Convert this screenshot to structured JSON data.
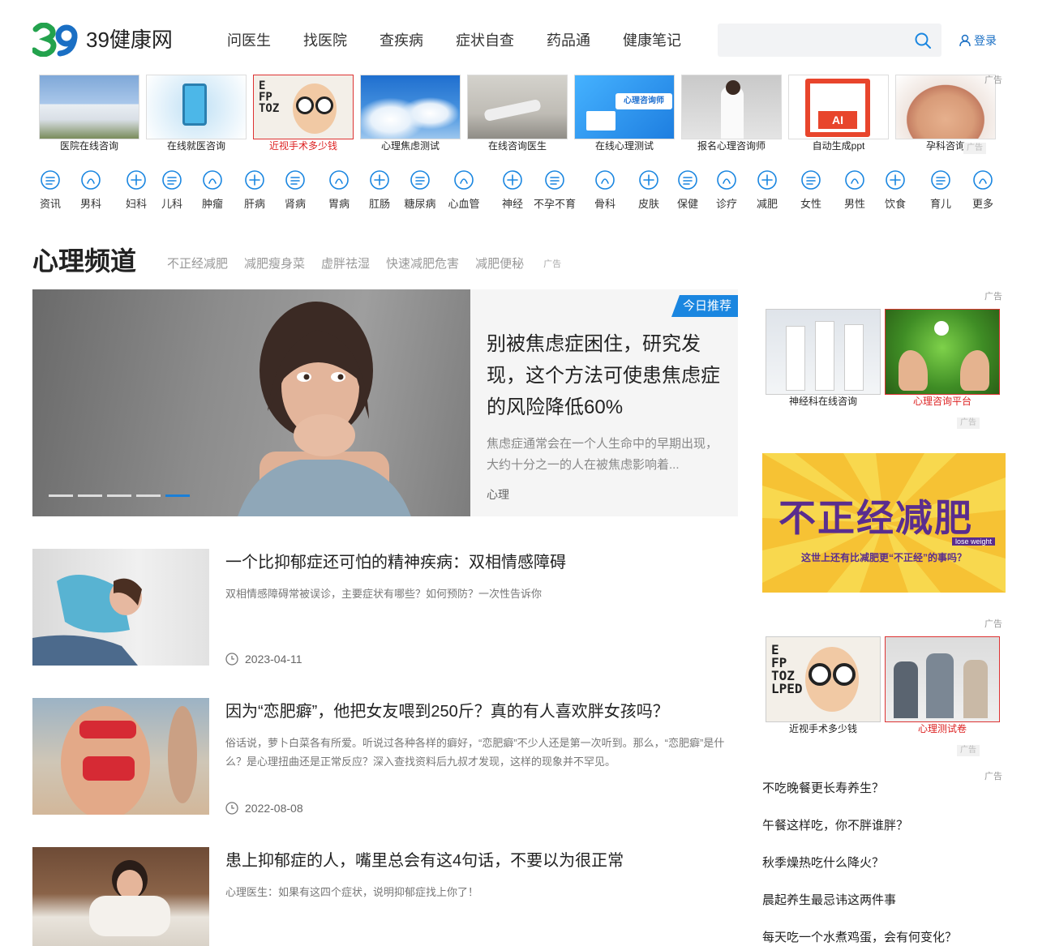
{
  "brand": {
    "logo_number": "39",
    "logo_text": "39健康网"
  },
  "nav": [
    "问医生",
    "找医院",
    "查疾病",
    "症状自查",
    "药品通",
    "健康笔记"
  ],
  "search": {
    "placeholder": ""
  },
  "login": {
    "label": "登录"
  },
  "ad_strip": {
    "items": [
      {
        "caption": "医院在线咨询",
        "highlight": false
      },
      {
        "caption": "在线就医咨询",
        "highlight": false
      },
      {
        "caption": "近视手术多少钱",
        "highlight": true
      },
      {
        "caption": "心理焦虑测试",
        "highlight": false
      },
      {
        "caption": "在线咨询医生",
        "highlight": false
      },
      {
        "caption": "在线心理测试",
        "highlight": false
      },
      {
        "caption": "报名心理咨询师",
        "highlight": false
      },
      {
        "caption": "自动生成ppt",
        "highlight": false
      },
      {
        "caption": "孕科咨询",
        "highlight": false
      }
    ],
    "ad_label": "广告",
    "close_label": "广告"
  },
  "thumb_texts": {
    "xinli": "心理咨询师",
    "ai": "AI"
  },
  "categories": [
    "资讯",
    "男科",
    "妇科",
    "儿科",
    "肿瘤",
    "肝病",
    "肾病",
    "胃病",
    "肛肠",
    "糖尿病",
    "心血管",
    "神经",
    "不孕不育",
    "骨科",
    "皮肤",
    "保健",
    "诊疗",
    "减肥",
    "女性",
    "男性",
    "饮食",
    "育儿",
    "更多"
  ],
  "channel": {
    "title": "心理频道",
    "links": [
      "不正经减肥",
      "减肥瘦身菜",
      "虚胖祛湿",
      "快速减肥危害",
      "减肥便秘"
    ],
    "ad_label": "广告"
  },
  "hero": {
    "badge": "今日推荐",
    "title": "别被焦虑症困住，研究发现，这个方法可使患焦虑症的风险降低60%",
    "desc": "焦虑症通常会在一个人生命中的早期出现，大约十分之一的人在被焦虑影响着...",
    "tag": "心理",
    "slide_count": 5,
    "active_slide": 5
  },
  "articles": [
    {
      "title": "一个比抑郁症还可怕的精神疾病：双相情感障碍",
      "desc": "双相情感障碍常被误诊，主要症状有哪些？如何预防？一次性告诉你",
      "date": "2023-04-11"
    },
    {
      "title": "因为“恋肥癖”，他把女友喂到250斤？真的有人喜欢胖女孩吗？",
      "desc": "俗话说，萝卜白菜各有所爱。听说过各种各样的癖好，“恋肥癖”不少人还是第一次听到。那么，“恋肥癖”是什么？是心理扭曲还是正常反应？深入查找资料后九叔才发现，这样的现象并不罕见。",
      "date": "2022-08-08"
    },
    {
      "title": "患上抑郁症的人，嘴里总会有这4句话，不要以为很正常",
      "desc": "心理医生：如果有这四个症状，说明抑郁症找上你了！",
      "date": ""
    }
  ],
  "sidebar": {
    "ad_label": "广告",
    "close_label": "广告",
    "group1": [
      {
        "caption": "神经科在线咨询",
        "highlight": false
      },
      {
        "caption": "心理咨询平台",
        "highlight": true
      }
    ],
    "banner": {
      "title": "不正经减肥",
      "sub": "这世上还有比减肥更“不正经”的事吗？",
      "en": "lose weight"
    },
    "group2": [
      {
        "caption": "近视手术多少钱",
        "highlight": false
      },
      {
        "caption": "心理测试卷",
        "highlight": true
      }
    ],
    "hot_list": [
      "不吃晚餐更长寿养生？",
      "午餐这样吃，你不胖谁胖？",
      "秋季燥热吃什么降火？",
      "晨起养生最忌讳这两件事",
      "每天吃一个水煮鸡蛋，会有何变化？"
    ]
  },
  "colors": {
    "accent": "#1a86e0",
    "logo_green": "#23a24d",
    "logo_blue": "#1a6fc4",
    "ad_red": "#d22"
  }
}
